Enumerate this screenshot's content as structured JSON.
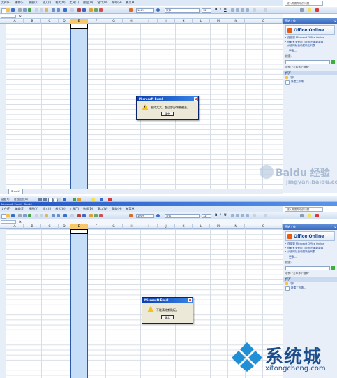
{
  "menu": [
    "文件(F)",
    "编辑(E)",
    "视图(V)",
    "插入(I)",
    "格式(O)",
    "工具(T)",
    "数据(D)",
    "窗口(W)",
    "帮助(H)",
    "新菜单"
  ],
  "help_placeholder": "键入需要帮助的问题",
  "toolbar": {
    "zoom": "100%",
    "font": "宋体",
    "size": "12"
  },
  "draw_toolbar": {
    "draw": "绘图(R)",
    "autoshape": "自选图形(U)"
  },
  "name_box": "",
  "fx": "fx",
  "second_window_title": "Microsoft Excel - Book1",
  "columns": [
    "A",
    "B",
    "C",
    "D",
    "E",
    "F",
    "G",
    "H",
    "I",
    "J",
    "K",
    "L",
    "M",
    "N",
    "O"
  ],
  "selected_column": "E",
  "sheet_tab": "Sheet1",
  "task_pane": {
    "title": "开始工作",
    "office_online": "Office Online",
    "links": [
      "连接到 Microsoft Office Online",
      "获取有关使用 Excel 的最新新闻",
      "从该网站自动更新此列表"
    ],
    "more": "更多...",
    "search_label": "搜索:",
    "example": "示例: \"打印多个副本\"",
    "open_section": "打开",
    "open_item": "打开...",
    "new_item": "新建工作簿..."
  },
  "dialog1": {
    "title": "Microsoft Excel",
    "message": "图片太大，超过部分将被截去。",
    "ok": "确定"
  },
  "dialog2": {
    "title": "Microsoft Excel",
    "message": "不能清除剪贴板。",
    "ok": "确定"
  },
  "watermark_baidu": {
    "text": "Baidu 经验",
    "url": "jingyan.baidu.com"
  },
  "watermark_xtc": {
    "text": "系统城",
    "url": "xitongcheng.com"
  },
  "colors": {
    "accent": "#2b58a8",
    "selected_col": "#c7def8",
    "warning": "#f4c21a",
    "taskpane": "#e8eff9"
  }
}
